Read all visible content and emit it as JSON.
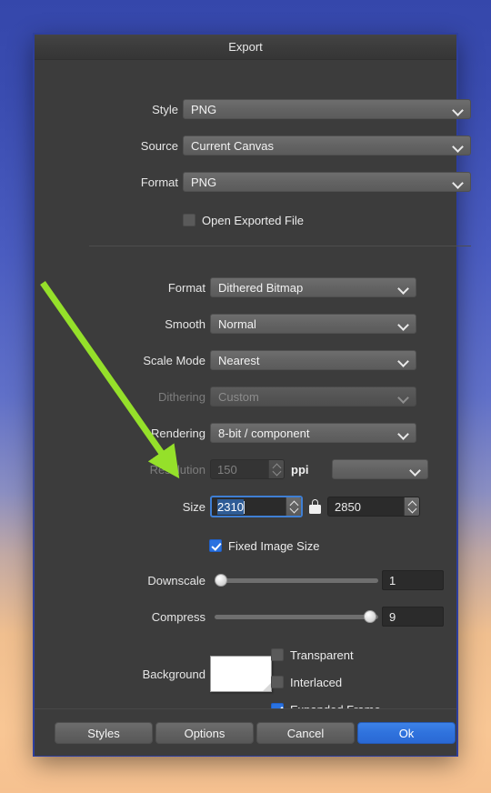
{
  "window": {
    "title": "Export"
  },
  "top_section": {
    "rows": [
      {
        "label": "Style",
        "value": "PNG"
      },
      {
        "label": "Source",
        "value": "Current Canvas"
      },
      {
        "label": "Format",
        "value": "PNG"
      }
    ],
    "open_exported_file": {
      "label": "Open Exported File",
      "checked": false
    }
  },
  "format_section": {
    "rows": [
      {
        "label": "Format",
        "value": "Dithered Bitmap",
        "disabled": false
      },
      {
        "label": "Smooth",
        "value": "Normal",
        "disabled": false
      },
      {
        "label": "Scale Mode",
        "value": "Nearest",
        "disabled": false
      },
      {
        "label": "Dithering",
        "value": "Custom",
        "disabled": true
      },
      {
        "label": "Rendering",
        "value": "8-bit / component",
        "disabled": false
      }
    ],
    "resolution": {
      "label": "Resolution",
      "value": "150",
      "unit": "ppi",
      "disabled": true,
      "preset_value": ""
    },
    "size": {
      "label": "Size",
      "width": "2310",
      "height": "2850",
      "width_focused": true,
      "lock_icon": "lock-closed-icon"
    },
    "fixed_image_size": {
      "label": "Fixed Image Size",
      "checked": true
    }
  },
  "sliders": [
    {
      "label": "Downscale",
      "value": "1",
      "percent": 0
    },
    {
      "label": "Compress",
      "value": "9",
      "percent": 94
    }
  ],
  "background": {
    "label": "Background",
    "color": "#ffffff"
  },
  "options": [
    {
      "label": "Transparent",
      "checked": false
    },
    {
      "label": "Interlaced",
      "checked": false
    },
    {
      "label": "Expanded Frame",
      "checked": true
    }
  ],
  "buttons": [
    {
      "label": "Styles",
      "primary": false
    },
    {
      "label": "Options",
      "primary": false
    },
    {
      "label": "Cancel",
      "primary": false
    },
    {
      "label": "Ok",
      "primary": true
    }
  ],
  "annotation": {
    "arrow_color": "#95e02a",
    "arrow_name": "green-pointer-arrow"
  },
  "colors": {
    "dialog_bg": "#3c3c3c",
    "accent_blue": "#2a72e0",
    "focus_blue": "#3f7fd4",
    "selection_blue": "#2e5c96"
  }
}
